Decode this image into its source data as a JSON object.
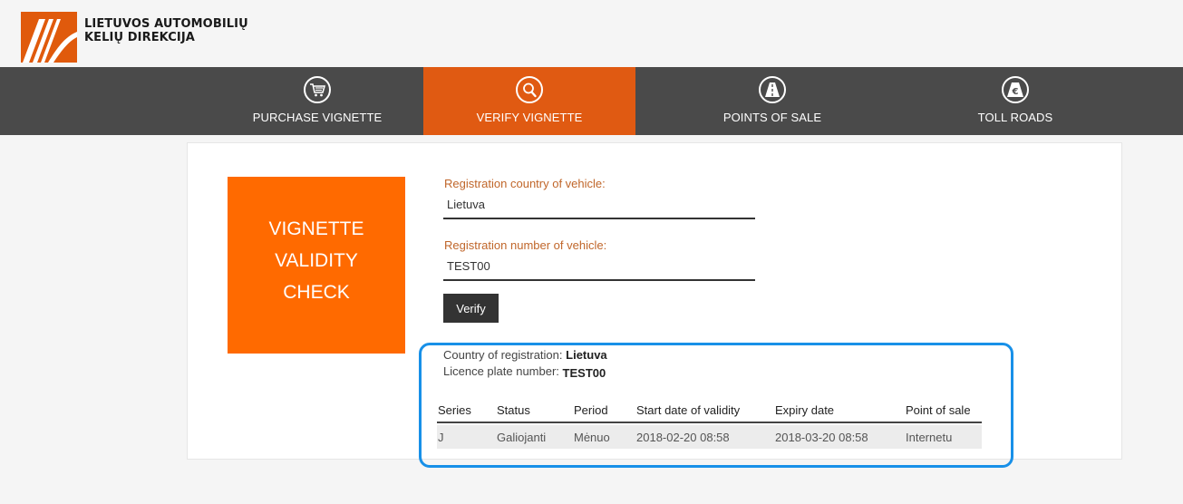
{
  "brand": {
    "line1": "LIETUVOS AUTOMOBILIŲ",
    "line2": "KELIŲ DIREKCIJA",
    "logo_color": "#e05a0c"
  },
  "nav": {
    "items": [
      {
        "label": "PURCHASE VIGNETTE",
        "icon": "cart-icon",
        "active": false
      },
      {
        "label": "VERIFY VIGNETTE",
        "icon": "magnifier-icon",
        "active": true
      },
      {
        "label": "POINTS OF SALE",
        "icon": "road-icon",
        "active": false
      },
      {
        "label": "TOLL ROADS",
        "icon": "euro-road-icon",
        "active": false
      }
    ],
    "background_color": "#4a4a4a",
    "active_color": "#e05a12"
  },
  "hero": {
    "line1": "VIGNETTE",
    "line2": "VALIDITY",
    "line3": "CHECK",
    "color": "#ff6a00"
  },
  "form": {
    "country_label": "Registration country of vehicle:",
    "country_value": "Lietuva",
    "plate_label": "Registration number of vehicle:",
    "plate_value": "TEST00",
    "verify_label": "Verify"
  },
  "result": {
    "country_label": "Country of registration:",
    "country_value": "Lietuva",
    "plate_label": "Licence plate number:",
    "plate_value": "TEST00",
    "highlight_color": "#1890e8",
    "table": {
      "headers": [
        "Series",
        "Status",
        "Period",
        "Start date of validity",
        "Expiry date",
        "Point of sale"
      ],
      "rows": [
        [
          "J",
          "Galiojanti",
          "Mėnuo",
          "2018-02-20 08:58",
          "2018-03-20 08:58",
          "Internetu"
        ]
      ]
    }
  }
}
